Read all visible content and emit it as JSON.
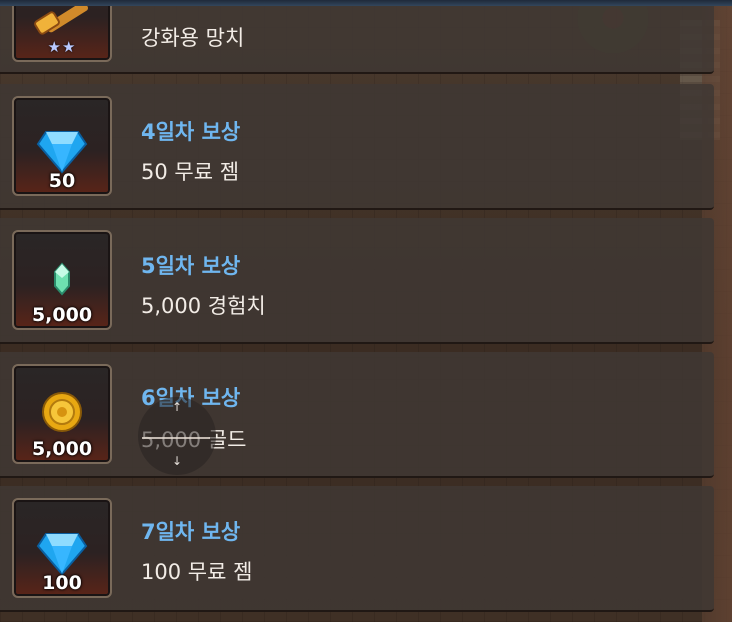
{
  "rewards": [
    {
      "title": "",
      "desc": "강화용 망치",
      "qty": "",
      "stars": "★★",
      "icon": "hammer-icon"
    },
    {
      "title": "4일차 보상",
      "desc": "50 무료 젬",
      "qty": "50",
      "icon": "gem-icon"
    },
    {
      "title": "5일차 보상",
      "desc": "5,000 경험치",
      "qty": "5,000",
      "icon": "exp-crystal-icon"
    },
    {
      "title": "6일차 보상",
      "desc": "5,000 골드",
      "qty": "5,000",
      "icon": "gold-coin-icon"
    },
    {
      "title": "7일차 보상",
      "desc": "100 무료 젬",
      "qty": "100",
      "icon": "gem-icon"
    }
  ],
  "scroll": {
    "up": "↑",
    "down": "↓"
  },
  "colors": {
    "title": "#6fb6ef",
    "desc": "#f2ece6",
    "gem": "#1fa6f0",
    "gold": "#e8a812"
  }
}
